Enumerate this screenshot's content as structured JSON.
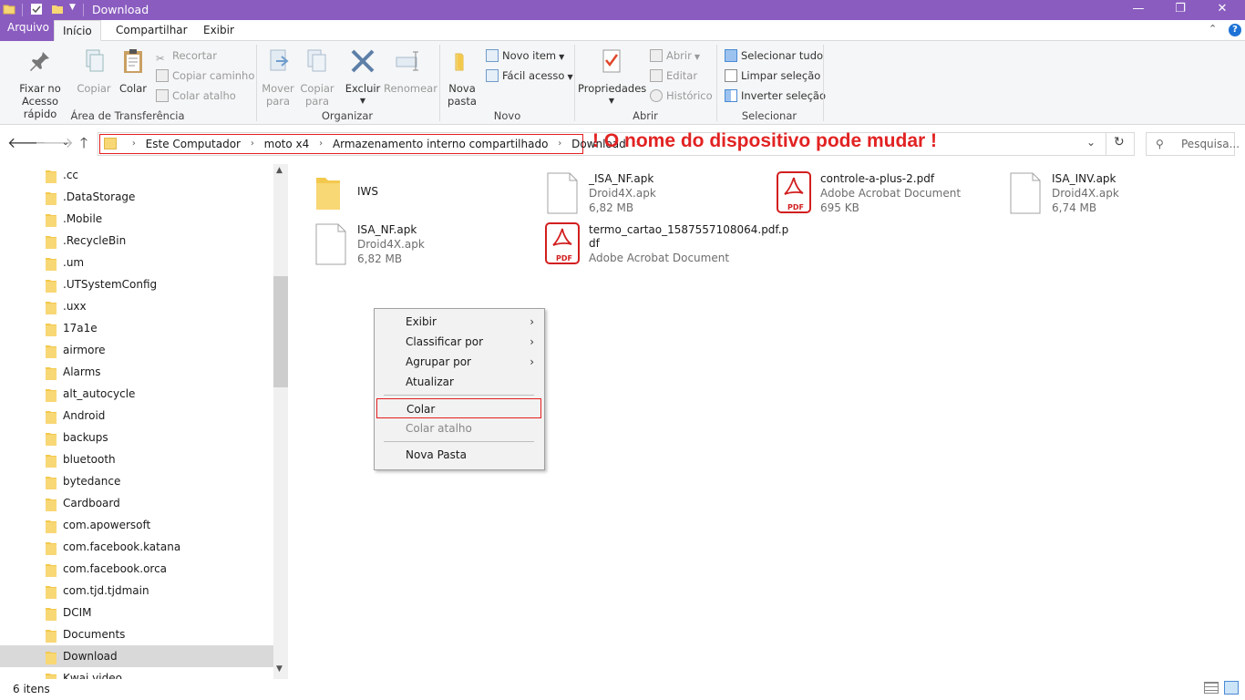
{
  "window": {
    "title": "Download",
    "minimize_icon": "—",
    "restore_icon": "❐",
    "close_icon": "✕"
  },
  "tabs": {
    "file": "Arquivo",
    "home": "Início",
    "share": "Compartilhar",
    "view": "Exibir"
  },
  "ribbon": {
    "clipboard": {
      "label": "Área de Transferência",
      "pin": [
        "Fixar no",
        "Acesso rápido"
      ],
      "copy": "Copiar",
      "paste": "Colar",
      "cut": "Recortar",
      "copy_path": "Copiar caminho",
      "paste_shortcut": "Colar atalho"
    },
    "organize": {
      "label": "Organizar",
      "move_to": [
        "Mover",
        "para"
      ],
      "copy_to": [
        "Copiar",
        "para"
      ],
      "delete": "Excluir",
      "rename": "Renomear"
    },
    "new": {
      "label": "Novo",
      "new_folder": [
        "Nova",
        "pasta"
      ],
      "new_item": "Novo item",
      "easy_access": "Fácil acesso"
    },
    "open": {
      "label": "Abrir",
      "properties": "Propriedades",
      "open": "Abrir",
      "edit": "Editar",
      "history": "Histórico"
    },
    "select": {
      "label": "Selecionar",
      "select_all": "Selecionar tudo",
      "select_none": "Limpar seleção",
      "invert": "Inverter seleção"
    }
  },
  "address": {
    "crumbs": [
      "Este Computador",
      "moto x4",
      "Armazenamento interno compartilhado",
      "Download"
    ],
    "annotation": "! O nome do dispositivo pode mudar !",
    "search_placeholder": "Pesquisa..."
  },
  "nav_items": [
    ".cc",
    ".DataStorage",
    ".Mobile",
    ".RecycleBin",
    ".um",
    ".UTSystemConfig",
    ".uxx",
    "17a1e",
    "airmore",
    "Alarms",
    "alt_autocycle",
    "Android",
    "backups",
    "bluetooth",
    "bytedance",
    "Cardboard",
    "com.apowersoft",
    "com.facebook.katana",
    "com.facebook.orca",
    "com.tjd.tjdmain",
    "DCIM",
    "Documents",
    "Download",
    "Kwai video"
  ],
  "nav_selected": "Download",
  "files": [
    {
      "name": "IWS",
      "type": "",
      "size": "",
      "icon": "folder-icon"
    },
    {
      "name": "_ISA_NF.apk",
      "type": "Droid4X.apk",
      "size": "6,82 MB",
      "icon": "file-icon"
    },
    {
      "name": "controle-a-plus-2.pdf",
      "type": "Adobe Acrobat Document",
      "size": "695 KB",
      "icon": "pdf-icon"
    },
    {
      "name": "ISA_INV.apk",
      "type": "Droid4X.apk",
      "size": "6,74 MB",
      "icon": "file-icon"
    },
    {
      "name": "ISA_NF.apk",
      "type": "Droid4X.apk",
      "size": "6,82 MB",
      "icon": "file-icon"
    },
    {
      "name_line1": "termo_cartao_1587557108064.pdf.p",
      "name_line2": "df",
      "type": "Adobe Acrobat Document",
      "icon": "pdf-icon"
    }
  ],
  "pdf_badge": "PDF",
  "context_menu": {
    "view": "Exibir",
    "sort_by": "Classificar por",
    "group_by": "Agrupar por",
    "refresh": "Atualizar",
    "paste": "Colar",
    "paste_shortcut": "Colar atalho",
    "new_folder": "Nova Pasta"
  },
  "status": {
    "count": "6 itens"
  },
  "colors": {
    "accent": "#8a5cbf",
    "highlight_red": "#e22222",
    "pdf_red": "#d21f1f",
    "folder_yellow": "#f8d775"
  }
}
